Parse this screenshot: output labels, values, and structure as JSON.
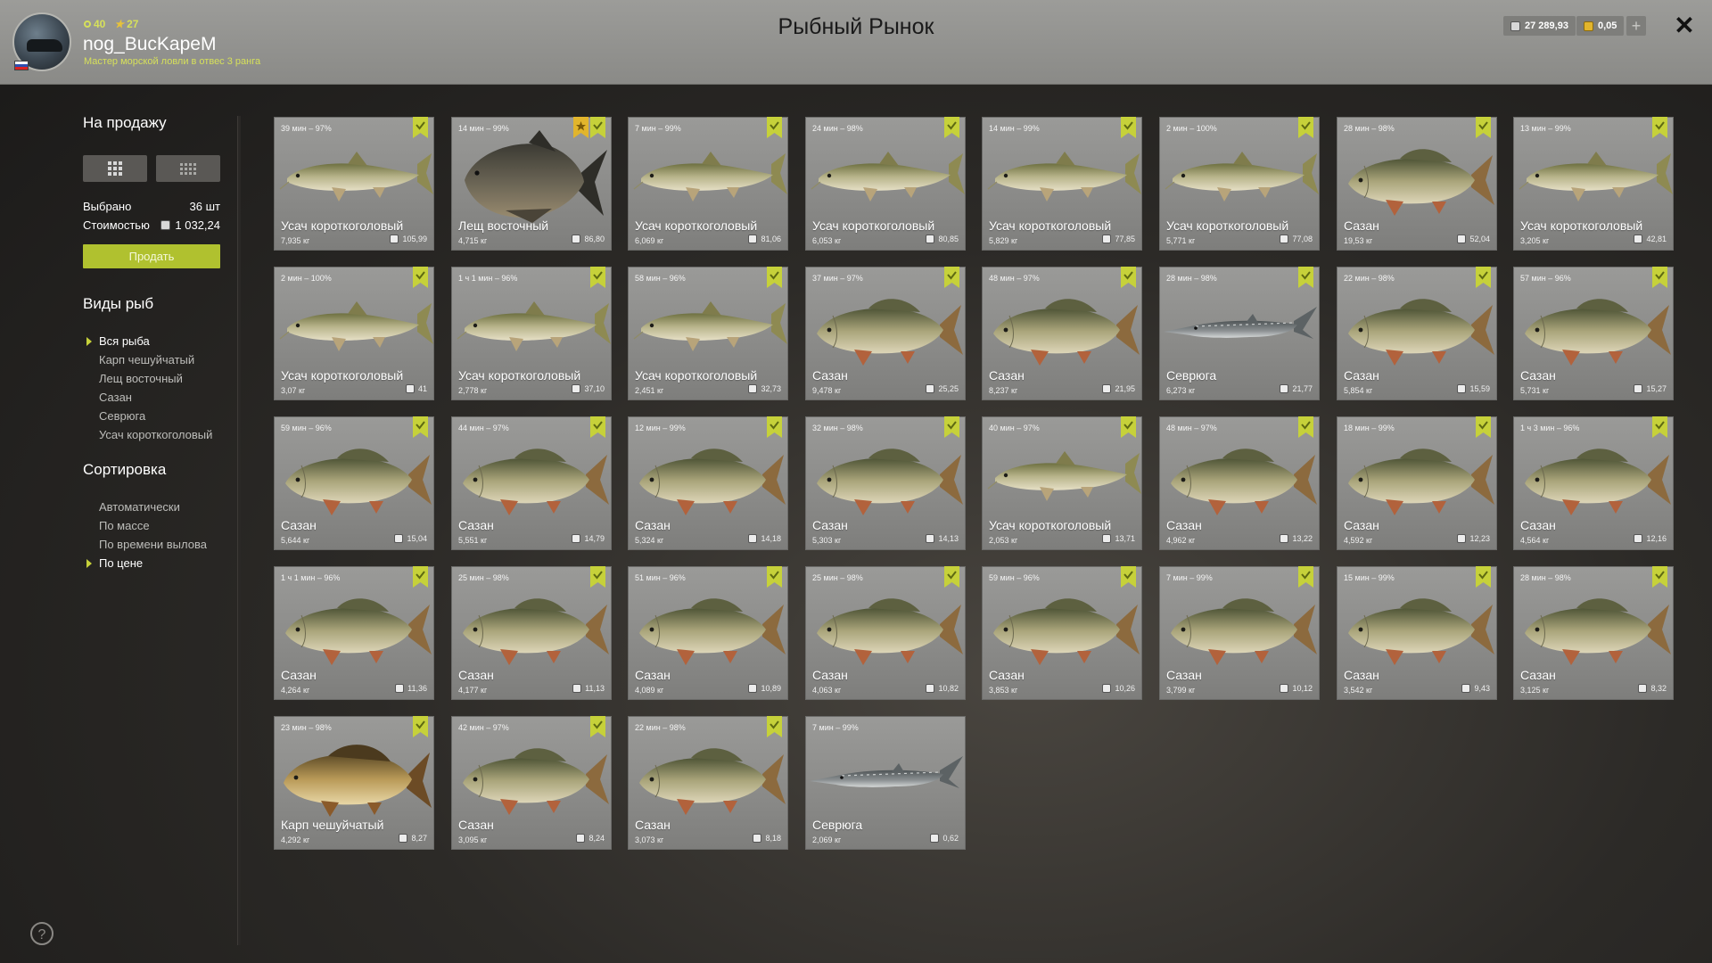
{
  "header": {
    "title": "Рыбный Рынок",
    "level": "40",
    "stars": "27",
    "username": "nog_BucKapeM",
    "rank": "Мастер морской ловли в отвес 3 ранга",
    "silver": "27 289,93",
    "gold": "0,05",
    "plus": "+",
    "close": "✕"
  },
  "sidebar": {
    "for_sale": "На продажу",
    "selected_label": "Выбрано",
    "selected_value": "36 шт",
    "cost_label": "Стоимостью",
    "cost_value": "1 032,24",
    "sell_button": "Продать",
    "species_title": "Виды рыб",
    "species": [
      {
        "label": "Вся рыба",
        "active": true
      },
      {
        "label": "Карп чешуйчатый",
        "active": false
      },
      {
        "label": "Лещ восточный",
        "active": false
      },
      {
        "label": "Сазан",
        "active": false
      },
      {
        "label": "Севрюга",
        "active": false
      },
      {
        "label": "Усач короткоголовый",
        "active": false
      }
    ],
    "sort_title": "Сортировка",
    "sort": [
      {
        "label": "Автоматически",
        "active": false
      },
      {
        "label": "По массе",
        "active": false
      },
      {
        "label": "По времени вылова",
        "active": false
      },
      {
        "label": "По цене",
        "active": true
      }
    ],
    "help": "?"
  },
  "colors": {
    "accent": "#b0c12f",
    "accent_text": "#d6e05a",
    "bookmark": "#c6d13a",
    "bookmark_gold": "#e2b52c"
  },
  "cards": [
    {
      "time": "39 мин – 97%",
      "name": "Усач короткоголовый",
      "weight": "7,935 кг",
      "price": "105,99",
      "fish": "barbel",
      "selected": true,
      "extra": false
    },
    {
      "time": "14 мин – 99%",
      "name": "Лещ восточный",
      "weight": "4,715 кг",
      "price": "86,80",
      "fish": "bream",
      "selected": true,
      "extra": true
    },
    {
      "time": "7 мин – 99%",
      "name": "Усач короткоголовый",
      "weight": "6,069 кг",
      "price": "81,06",
      "fish": "barbel",
      "selected": true,
      "extra": false
    },
    {
      "time": "24 мин – 98%",
      "name": "Усач короткоголовый",
      "weight": "6,053 кг",
      "price": "80,85",
      "fish": "barbel",
      "selected": true,
      "extra": false
    },
    {
      "time": "14 мин – 99%",
      "name": "Усач короткоголовый",
      "weight": "5,829 кг",
      "price": "77,85",
      "fish": "barbel",
      "selected": true,
      "extra": false
    },
    {
      "time": "2 мин – 100%",
      "name": "Усач короткоголовый",
      "weight": "5,771 кг",
      "price": "77,08",
      "fish": "barbel",
      "selected": true,
      "extra": false
    },
    {
      "time": "28 мин – 98%",
      "name": "Сазан",
      "weight": "19,53 кг",
      "price": "52,04",
      "fish": "carp",
      "selected": true,
      "extra": false
    },
    {
      "time": "13 мин – 99%",
      "name": "Усач короткоголовый",
      "weight": "3,205 кг",
      "price": "42,81",
      "fish": "barbel",
      "selected": true,
      "extra": false
    },
    {
      "time": "2 мин – 100%",
      "name": "Усач короткоголовый",
      "weight": "3,07 кг",
      "price": "41",
      "fish": "barbel",
      "selected": true,
      "extra": false
    },
    {
      "time": "1 ч 1 мин – 96%",
      "name": "Усач короткоголовый",
      "weight": "2,778 кг",
      "price": "37,10",
      "fish": "barbel",
      "selected": true,
      "extra": false
    },
    {
      "time": "58 мин – 96%",
      "name": "Усач короткоголовый",
      "weight": "2,451 кг",
      "price": "32,73",
      "fish": "barbel",
      "selected": true,
      "extra": false
    },
    {
      "time": "37 мин – 97%",
      "name": "Сазан",
      "weight": "9,478 кг",
      "price": "25,25",
      "fish": "carp",
      "selected": true,
      "extra": false
    },
    {
      "time": "48 мин – 97%",
      "name": "Сазан",
      "weight": "8,237 кг",
      "price": "21,95",
      "fish": "carp",
      "selected": true,
      "extra": false
    },
    {
      "time": "28 мин – 98%",
      "name": "Севрюга",
      "weight": "6,273 кг",
      "price": "21,77",
      "fish": "sturgeon",
      "selected": true,
      "extra": false
    },
    {
      "time": "22 мин – 98%",
      "name": "Сазан",
      "weight": "5,854 кг",
      "price": "15,59",
      "fish": "carp",
      "selected": true,
      "extra": false
    },
    {
      "time": "57 мин – 96%",
      "name": "Сазан",
      "weight": "5,731 кг",
      "price": "15,27",
      "fish": "carp",
      "selected": true,
      "extra": false
    },
    {
      "time": "59 мин – 96%",
      "name": "Сазан",
      "weight": "5,644 кг",
      "price": "15,04",
      "fish": "carp",
      "selected": true,
      "extra": false
    },
    {
      "time": "44 мин – 97%",
      "name": "Сазан",
      "weight": "5,551 кг",
      "price": "14,79",
      "fish": "carp",
      "selected": true,
      "extra": false
    },
    {
      "time": "12 мин – 99%",
      "name": "Сазан",
      "weight": "5,324 кг",
      "price": "14,18",
      "fish": "carp",
      "selected": true,
      "extra": false
    },
    {
      "time": "32 мин – 98%",
      "name": "Сазан",
      "weight": "5,303 кг",
      "price": "14,13",
      "fish": "carp",
      "selected": true,
      "extra": false
    },
    {
      "time": "40 мин – 97%",
      "name": "Усач короткоголовый",
      "weight": "2,053 кг",
      "price": "13,71",
      "fish": "barbel",
      "selected": true,
      "extra": false
    },
    {
      "time": "48 мин – 97%",
      "name": "Сазан",
      "weight": "4,962 кг",
      "price": "13,22",
      "fish": "carp",
      "selected": true,
      "extra": false
    },
    {
      "time": "18 мин – 99%",
      "name": "Сазан",
      "weight": "4,592 кг",
      "price": "12,23",
      "fish": "carp",
      "selected": true,
      "extra": false
    },
    {
      "time": "1 ч 3 мин – 96%",
      "name": "Сазан",
      "weight": "4,564 кг",
      "price": "12,16",
      "fish": "carp",
      "selected": true,
      "extra": false
    },
    {
      "time": "1 ч 1 мин – 96%",
      "name": "Сазан",
      "weight": "4,264 кг",
      "price": "11,36",
      "fish": "carp",
      "selected": true,
      "extra": false
    },
    {
      "time": "25 мин – 98%",
      "name": "Сазан",
      "weight": "4,177 кг",
      "price": "11,13",
      "fish": "carp",
      "selected": true,
      "extra": false
    },
    {
      "time": "51 мин – 96%",
      "name": "Сазан",
      "weight": "4,089 кг",
      "price": "10,89",
      "fish": "carp",
      "selected": true,
      "extra": false
    },
    {
      "time": "25 мин – 98%",
      "name": "Сазан",
      "weight": "4,063 кг",
      "price": "10,82",
      "fish": "carp",
      "selected": true,
      "extra": false
    },
    {
      "time": "59 мин – 96%",
      "name": "Сазан",
      "weight": "3,853 кг",
      "price": "10,26",
      "fish": "carp",
      "selected": true,
      "extra": false
    },
    {
      "time": "7 мин – 99%",
      "name": "Сазан",
      "weight": "3,799 кг",
      "price": "10,12",
      "fish": "carp",
      "selected": true,
      "extra": false
    },
    {
      "time": "15 мин – 99%",
      "name": "Сазан",
      "weight": "3,542 кг",
      "price": "9,43",
      "fish": "carp",
      "selected": true,
      "extra": false
    },
    {
      "time": "28 мин – 98%",
      "name": "Сазан",
      "weight": "3,125 кг",
      "price": "8,32",
      "fish": "carp",
      "selected": true,
      "extra": false
    },
    {
      "time": "23 мин – 98%",
      "name": "Карп чешуйчатый",
      "weight": "4,292 кг",
      "price": "8,27",
      "fish": "commoncarp",
      "selected": true,
      "extra": false
    },
    {
      "time": "42 мин – 97%",
      "name": "Сазан",
      "weight": "3,095 кг",
      "price": "8,24",
      "fish": "carp",
      "selected": true,
      "extra": false
    },
    {
      "time": "22 мин – 98%",
      "name": "Сазан",
      "weight": "3,073 кг",
      "price": "8,18",
      "fish": "carp",
      "selected": true,
      "extra": false
    },
    {
      "time": "7 мин – 99%",
      "name": "Севрюга",
      "weight": "2,069 кг",
      "price": "0,62",
      "fish": "sturgeon",
      "selected": false,
      "extra": false
    }
  ]
}
